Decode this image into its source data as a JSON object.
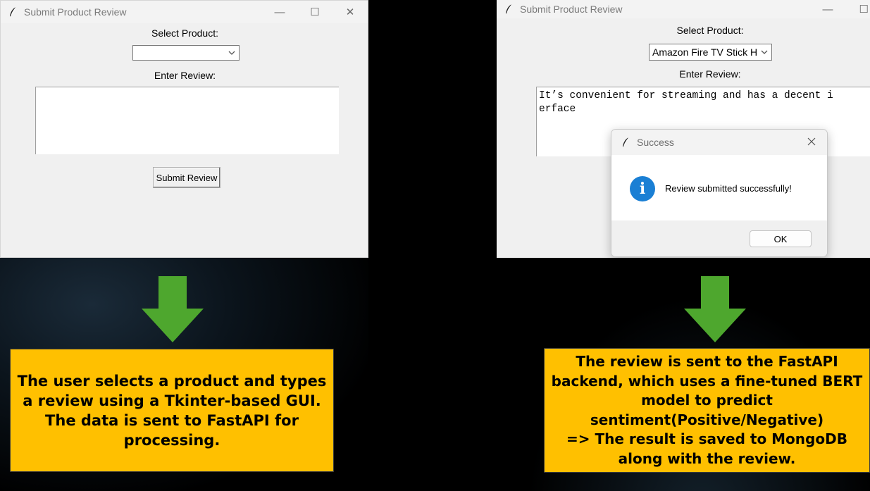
{
  "left_window": {
    "title": "Submit Product Review",
    "select_label": "Select Product:",
    "selected_product": "",
    "review_label": "Enter Review:",
    "review_text": "",
    "submit_label": "Submit Review",
    "controls": {
      "minimize": "—",
      "maximize": "☐",
      "close": "✕"
    }
  },
  "right_window": {
    "title": "Submit Product Review",
    "select_label": "Select Product:",
    "selected_product": "Amazon Fire TV Stick H",
    "review_label": "Enter Review:",
    "review_text": "It’s convenient for streaming and has a decent i\nerface",
    "controls": {
      "minimize": "—",
      "maximize": "☐"
    }
  },
  "message_box": {
    "title": "Success",
    "message": "Review submitted successfully!",
    "ok_label": "OK",
    "icon": "info-icon",
    "icon_glyph": "i"
  },
  "callouts": {
    "left": "The user selects a product and types a review using a Tkinter-based GUI. The data is sent to FastAPI for processing.",
    "right": "The review is sent to the FastAPI backend, which uses a fine-tuned BERT model to predict sentiment(Positive/Negative)\n=> The result is saved to MongoDB along with the review."
  },
  "colors": {
    "callout_fill": "#ffc000",
    "arrow_green": "#4ea72e",
    "info_blue": "#1a7fd4",
    "background": "#000000"
  }
}
